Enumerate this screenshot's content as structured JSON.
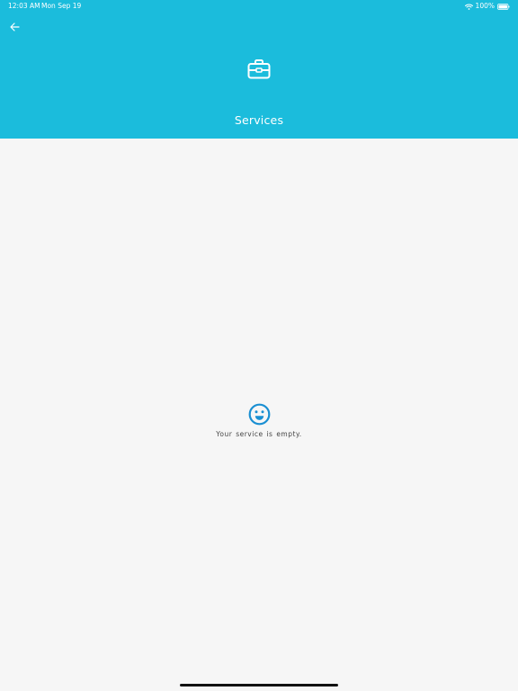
{
  "status_bar": {
    "time": "12:03 AM",
    "date": "Mon Sep 19",
    "battery_percent": "100%",
    "wifi_icon": "wifi-icon",
    "battery_icon": "battery-icon"
  },
  "header": {
    "background_color": "#1bbcdc",
    "back_icon": "arrow-left-icon",
    "hero_icon": "briefcase-icon",
    "title": "Services"
  },
  "main": {
    "background_color": "#f6f6f6",
    "empty_state": {
      "icon": "smile-icon",
      "icon_color": "#1a8fd2",
      "message": "Your service is empty."
    }
  }
}
